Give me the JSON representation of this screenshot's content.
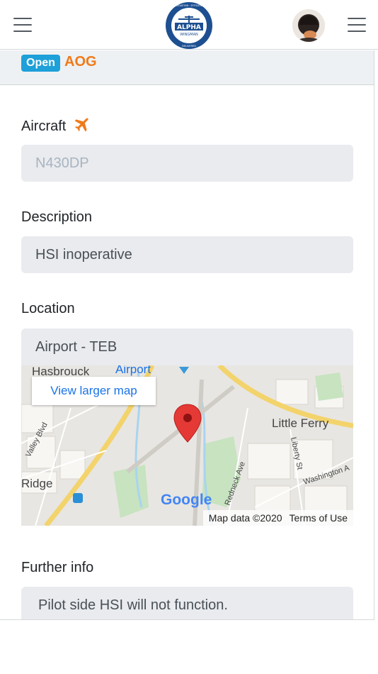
{
  "header": {
    "menu_left_icon": "hamburger-menu-icon",
    "logo": {
      "top_arc": "INNOVATION · EFFICIENCY",
      "brand": "ALPHA",
      "sub": "WINGMAN",
      "bottom_arc": "DELIVERED"
    },
    "menu_right_icon": "hamburger-menu-icon"
  },
  "status": {
    "badge": "Open",
    "type": "AOG"
  },
  "aircraft": {
    "label": "Aircraft",
    "icon": "airplane-icon",
    "value": "N430DP"
  },
  "description": {
    "label": "Description",
    "value": "HSI inoperative"
  },
  "location": {
    "label": "Location",
    "value": "Airport - TEB",
    "map": {
      "larger_map_link": "View larger map",
      "places": {
        "hasbrouck": "Hasbrouck",
        "airport": "Airport",
        "little_ferry": "Little Ferry",
        "ridge": "Ridge",
        "valley_blvd": "Valley Blvd",
        "redneck_ave": "Redneck Ave",
        "liberty_st": "Liberty St",
        "washington_ave": "Washington A"
      },
      "google_logo": "Google",
      "attribution": "Map data ©2020",
      "terms": "Terms of Use"
    }
  },
  "further_info": {
    "label": "Further info",
    "value": "Pilot side HSI will not function."
  },
  "colors": {
    "badge_blue": "#1ea0d9",
    "aog_orange": "#f07a1a",
    "field_bg": "#e9ebee",
    "map_link": "#1a73e8",
    "pin_red": "#e53935"
  }
}
